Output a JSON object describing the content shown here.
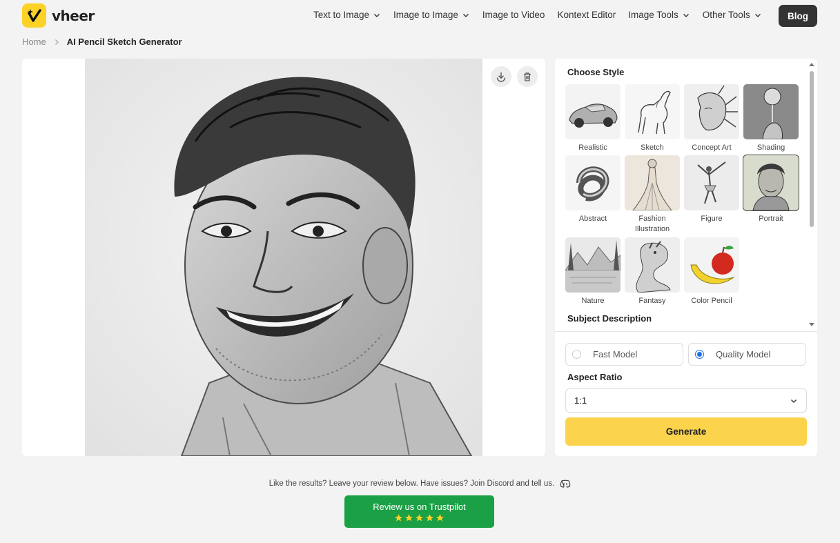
{
  "brand": {
    "name": "vheer"
  },
  "nav": {
    "items": [
      {
        "label": "Text to Image",
        "dropdown": true
      },
      {
        "label": "Image to Image",
        "dropdown": true
      },
      {
        "label": "Image to Video",
        "dropdown": false
      },
      {
        "label": "Kontext Editor",
        "dropdown": false
      },
      {
        "label": "Image Tools",
        "dropdown": true
      },
      {
        "label": "Other Tools",
        "dropdown": true
      }
    ],
    "blog": "Blog"
  },
  "breadcrumb": {
    "home": "Home",
    "current": "AI Pencil Sketch Generator"
  },
  "panel": {
    "choose_style": "Choose Style",
    "styles": [
      {
        "label": "Realistic",
        "selected": false
      },
      {
        "label": "Sketch",
        "selected": false
      },
      {
        "label": "Concept Art",
        "selected": false
      },
      {
        "label": "Shading",
        "selected": false
      },
      {
        "label": "Abstract",
        "selected": false
      },
      {
        "label": "Fashion Illustration",
        "selected": false
      },
      {
        "label": "Figure",
        "selected": false
      },
      {
        "label": "Portrait",
        "selected": true
      },
      {
        "label": "Nature",
        "selected": false
      },
      {
        "label": "Fantasy",
        "selected": false
      },
      {
        "label": "Color Pencil",
        "selected": false
      }
    ],
    "subject_description": "Subject Description",
    "models": [
      {
        "label": "Fast Model",
        "selected": false
      },
      {
        "label": "Quality Model",
        "selected": true
      }
    ],
    "aspect_ratio_label": "Aspect Ratio",
    "aspect_ratio_value": "1:1",
    "generate": "Generate"
  },
  "footer": {
    "feedback": "Like the results? Leave your review below. Have issues? Join Discord and tell us.",
    "trustpilot": "Review us on Trustpilot",
    "rating_stars": 5
  },
  "colors": {
    "brand_yellow": "#fcd226",
    "generate_yellow": "#fcd34d",
    "radio_blue": "#1a6ee6",
    "trustpilot_green": "#1ca045"
  }
}
